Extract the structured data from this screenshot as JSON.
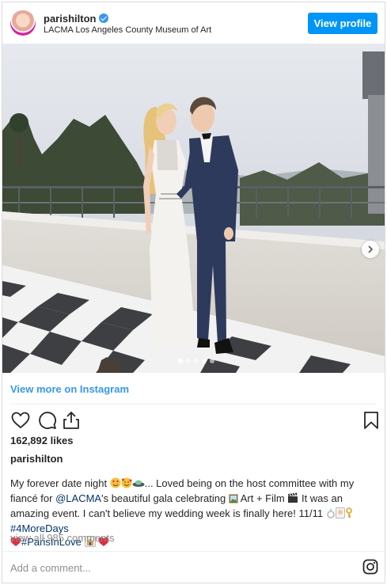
{
  "header": {
    "username": "parishilton",
    "location": "LACMA Los Angeles County Museum of Art",
    "view_profile_label": "View profile"
  },
  "media": {
    "slide_count": 5,
    "active_slide": 1
  },
  "view_more_label": "View more on Instagram",
  "actions": {
    "like_icon": "heart-icon",
    "comment_icon": "comment-icon",
    "share_icon": "share-icon",
    "save_icon": "bookmark-icon"
  },
  "likes_label": "162,892 likes",
  "poster_username": "parishilton",
  "caption": {
    "part1": "My forever date night ",
    "part2": "... Loved being on the host committee with my fiancé for ",
    "mention": "@LACMA",
    "part3": "'s beautiful gala celebrating ",
    "part4": " Art + Film ",
    "part5": " It was an amazing event. I can't believe my wedding week is finally here! 11/11 ",
    "hashtag1": "#4MoreDays",
    "hashtag2": "#ParisInLove"
  },
  "comments_label": "view all 985 comments",
  "add_comment_placeholder": "Add a comment...",
  "colors": {
    "accent": "#0095f6",
    "link": "#3897f0",
    "hashtag": "#003569",
    "muted": "#8e8e8e"
  }
}
